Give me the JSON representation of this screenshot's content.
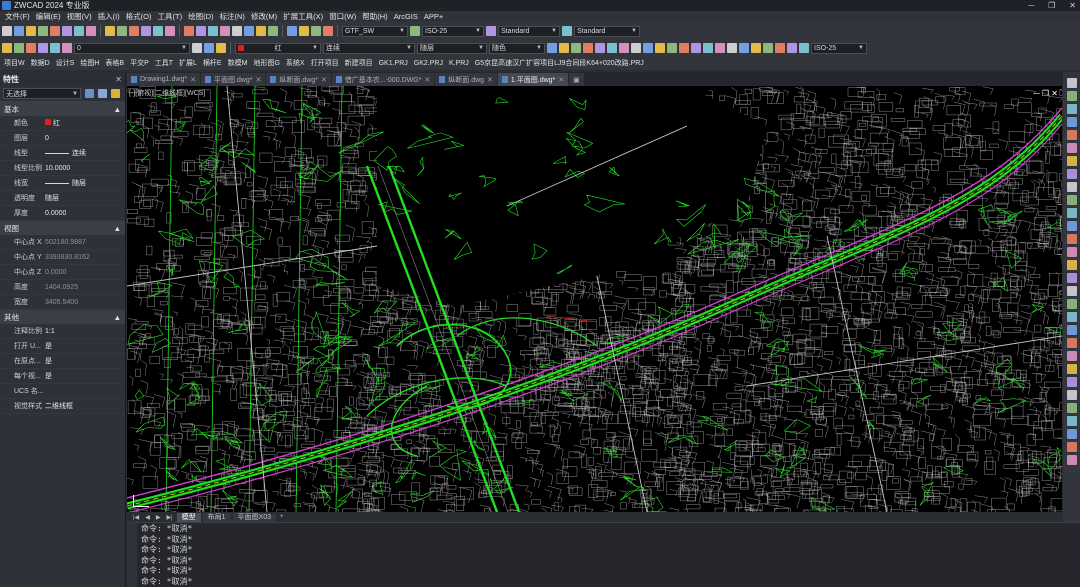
{
  "window": {
    "title": "ZWCAD 2024 专业版",
    "minimize": "─",
    "restore": "❐",
    "close": "✕"
  },
  "menus": [
    "文件(F)",
    "编辑(E)",
    "视图(V)",
    "插入(I)",
    "格式(O)",
    "工具(T)",
    "绘图(D)",
    "标注(N)",
    "修改(M)",
    "扩展工具(X)",
    "窗口(W)",
    "帮助(H)",
    "ArcGIS",
    "APP+"
  ],
  "toolbar1": {
    "text_style": "GTF_SW",
    "dim_style": "ISO-25",
    "table_style": "Standard",
    "mleader_style": "Standard"
  },
  "toolbar2": {
    "layer": "0",
    "color": "红",
    "linetype": "连续",
    "lineweight": "随层",
    "plotstyle": "随色",
    "dim_style": "ISO-25"
  },
  "toolbar3": [
    "项目W",
    "数据D",
    "设计S",
    "绘图H",
    "表格B",
    "平交P",
    "工具T",
    "扩展L",
    "横杆E",
    "数模M",
    "地形图G",
    "系统X",
    "打开项目",
    "新建项目",
    "GK1.PRJ",
    "GK2.PRJ",
    "K.PRJ",
    "G5京昆高速汉广扩容项目LJ9合同段K64+020改路.PRJ"
  ],
  "properties": {
    "title": "特性",
    "close": "✕",
    "selection": "无选择",
    "sections": [
      {
        "name": "基本",
        "collapse": "▲",
        "rows": [
          {
            "key": "颜色",
            "value": "红",
            "swatch": "#e02020"
          },
          {
            "key": "图层",
            "value": "0"
          },
          {
            "key": "线型",
            "value": "连续",
            "line": true
          },
          {
            "key": "线型比例",
            "value": "10.0000"
          },
          {
            "key": "线宽",
            "value": "随层",
            "line": true
          },
          {
            "key": "透明度",
            "value": "随层"
          },
          {
            "key": "厚度",
            "value": "0.0000"
          }
        ]
      },
      {
        "name": "视图",
        "collapse": "▲",
        "rows": [
          {
            "key": "中心点 X",
            "value": "502180.9887",
            "dim": true
          },
          {
            "key": "中心点 Y",
            "value": "3393830.8162",
            "dim": true
          },
          {
            "key": "中心点 Z",
            "value": "0.0000",
            "dim": true
          },
          {
            "key": "高度",
            "value": "1404.0925",
            "dim": true
          },
          {
            "key": "宽度",
            "value": "3405.5400",
            "dim": true
          }
        ]
      },
      {
        "name": "其他",
        "collapse": "▲",
        "rows": [
          {
            "key": "注释比例",
            "value": "1:1"
          },
          {
            "key": "打开 U...",
            "value": "是"
          },
          {
            "key": "在原点...",
            "value": "是"
          },
          {
            "key": "每个视...",
            "value": "是"
          },
          {
            "key": "UCS 名...",
            "value": ""
          },
          {
            "key": "视觉样式",
            "value": "二维线框"
          }
        ]
      }
    ]
  },
  "doc_tabs": [
    {
      "label": "Drawing1.dwg*",
      "active": false
    },
    {
      "label": "平面图.dwg*",
      "active": false
    },
    {
      "label": "纵断面.dwg*",
      "active": false
    },
    {
      "label": "借广基本农...-000.DWG*",
      "active": false
    },
    {
      "label": "纵断面.dwg",
      "active": false
    },
    {
      "label": "1.平面图.dwg*",
      "active": true
    }
  ],
  "canvas": {
    "viewport_label": "[-][俯视][二维线框][WCS]",
    "controls": "─ ❐ ✕"
  },
  "layout_tabs": [
    {
      "label": "模型",
      "active": true
    },
    {
      "label": "布局1",
      "active": false
    },
    {
      "label": "平面图X03",
      "active": false
    }
  ],
  "layout_nav": [
    "|◀",
    "◀",
    "▶",
    "▶|"
  ],
  "layout_add": "+",
  "command_lines": [
    "命令: *取消*",
    "命令: *取消*",
    "命令: *取消*",
    "命令: *取消*",
    "命令: *取消*",
    "命令: *取消*"
  ],
  "colors": {
    "background": "#000000",
    "road_green": "#22e022",
    "road_magenta": "#d040d0",
    "centerline_yellow": "#e8e020",
    "parcel_white": "#c8c8c8"
  }
}
